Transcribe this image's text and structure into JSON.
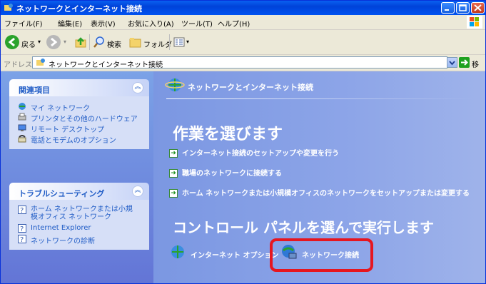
{
  "window": {
    "title": "ネットワークとインターネット接続"
  },
  "menu": {
    "items": [
      "ファイル(F)",
      "編集(E)",
      "表示(V)",
      "お気に入り(A)",
      "ツール(T)",
      "ヘルプ(H)"
    ]
  },
  "toolbar": {
    "back": "戻る",
    "search": "検索",
    "folders": "フォルダ"
  },
  "address": {
    "label": "アドレス(D)",
    "value": "ネットワークとインターネット接続",
    "go": "移動"
  },
  "sidebar": {
    "related": {
      "title": "関連項目",
      "items": [
        "マイ ネットワーク",
        "プリンタとその他のハードウェア",
        "リモート デスクトップ",
        "電話とモデムのオプション"
      ]
    },
    "troubleshoot": {
      "title": "トラブルシューティング",
      "items": [
        "ホーム ネットワークまたは小規模オフィス ネットワーク",
        "Internet Explorer",
        "ネットワークの診断"
      ],
      "item0_line1": "ホーム ネットワークまたは小規",
      "item0_line2": "模オフィス ネットワーク"
    }
  },
  "main": {
    "category": "ネットワークとインターネット接続",
    "pick_task": "作業を選びます",
    "tasks": [
      "インターネット接続のセットアップや変更を行う",
      "職場のネットワークに接続する",
      "ホーム ネットワークまたは小規模オフィスのネットワークをセットアップまたは変更する"
    ],
    "pick_cp": "コントロール パネルを選んで実行します",
    "cp_items": [
      "インターネット オプション",
      "ネットワーク接続"
    ]
  },
  "colors": {
    "highlight": "#e6161f",
    "titlebar": "#0043d9",
    "panel_bg": "#d6dff7"
  }
}
